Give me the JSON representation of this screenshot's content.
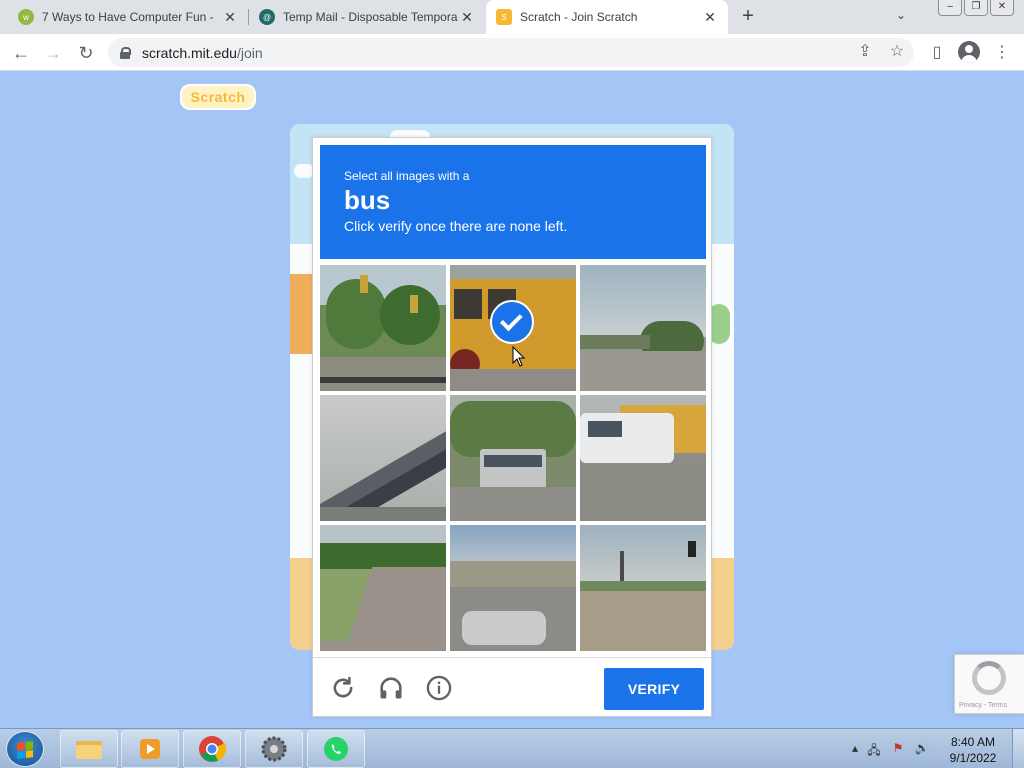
{
  "browser": {
    "tabs": [
      {
        "title": "7 Ways to Have Computer Fun -",
        "favicon": "wikihow-icon",
        "color": "#93b843",
        "active": false
      },
      {
        "title": "Temp Mail - Disposable Tempora",
        "favicon": "tempmail-icon",
        "color": "#1f6d6a",
        "active": false
      },
      {
        "title": "Scratch - Join Scratch",
        "favicon": "scratch-icon",
        "color": "#f7b733",
        "active": true
      }
    ],
    "new_tab": "+",
    "url_host": "scratch.mit.edu",
    "url_path": "/join"
  },
  "page": {
    "logo_text": "Scratch"
  },
  "captcha": {
    "instruction": "Select all images with a",
    "target": "bus",
    "hint": "Click verify once there are none left.",
    "verify_label": "VERIFY",
    "accent": "#1a73e8",
    "tiles": [
      {
        "name": "tile-traffic-light-trees",
        "selected": false
      },
      {
        "name": "tile-school-bus",
        "selected": true
      },
      {
        "name": "tile-field-tree",
        "selected": false
      },
      {
        "name": "tile-bridge-overpass",
        "selected": false
      },
      {
        "name": "tile-bus-street",
        "selected": false
      },
      {
        "name": "tile-van-school-bus",
        "selected": false
      },
      {
        "name": "tile-path-grass",
        "selected": false
      },
      {
        "name": "tile-car-road",
        "selected": false
      },
      {
        "name": "tile-intersection-signal",
        "selected": false
      }
    ]
  },
  "recaptcha_badge": {
    "text": "Privacy - Terms"
  },
  "taskbar": {
    "time": "8:40 AM",
    "date": "9/1/2022"
  }
}
